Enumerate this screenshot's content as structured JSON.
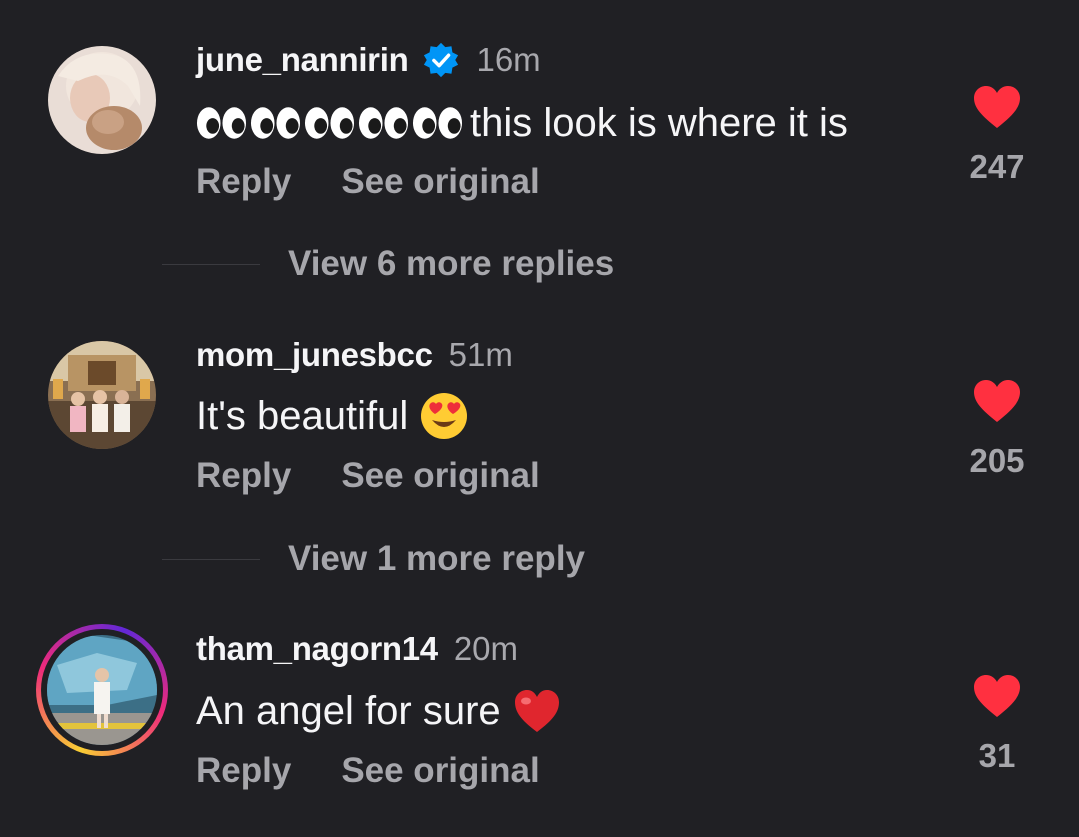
{
  "comments": [
    {
      "username": "june_nannirin",
      "verified": true,
      "time": "16m",
      "text": "this look is where it is",
      "leading_emoji": "eyes-emoji x5",
      "reply_label": "Reply",
      "see_original_label": "See original",
      "likes": "247"
    },
    {
      "username": "mom_junesbcc",
      "verified": false,
      "time": "51m",
      "text": "It's beautiful",
      "trailing_emoji": "heart-eyes-emoji",
      "reply_label": "Reply",
      "see_original_label": "See original",
      "likes": "205"
    },
    {
      "username": "tham_nagorn14",
      "verified": false,
      "story_ring": true,
      "time": "20m",
      "text": "An angel for sure",
      "trailing_emoji": "red-heart-emoji",
      "reply_label": "Reply",
      "see_original_label": "See original",
      "likes": "31"
    }
  ],
  "view_more": [
    "View 6 more replies",
    "View 1 more reply"
  ],
  "colors": {
    "background": "#202024",
    "text": "#f5f5f7",
    "muted": "#a6a6ab",
    "like": "#ff3040",
    "verified": "#0095f6"
  }
}
